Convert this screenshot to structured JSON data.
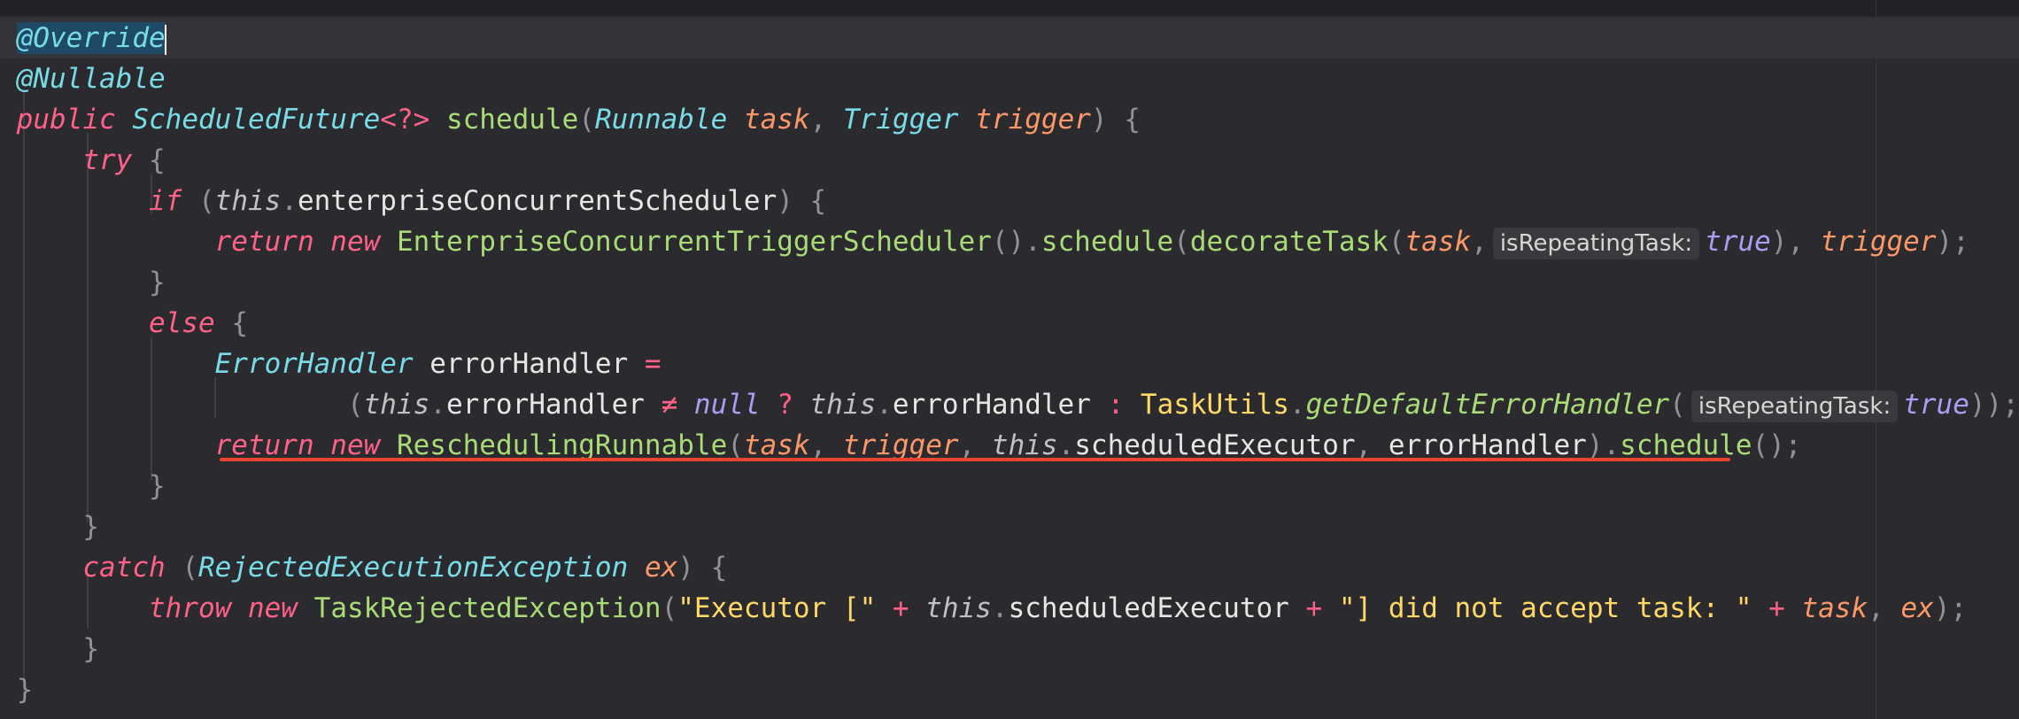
{
  "editor": {
    "language": "Java",
    "theme_colors": {
      "background": "#2b2a2e",
      "keyword": "#ff6188",
      "type": "#78dce8",
      "function": "#a9dc76",
      "parameter": "#fc9867",
      "literal": "#ab9df2",
      "string": "#ffd866",
      "error_underline": "#e8442e"
    },
    "tokens": {
      "override": "@Override",
      "override_head": "@Overrid",
      "override_tail": "e",
      "nullable": "@Nullable",
      "public": "public",
      "scheduled_future": "ScheduledFuture",
      "generic": "<?>",
      "schedule": "schedule",
      "runnable": "Runnable",
      "task": "task",
      "trigger_type": "Trigger",
      "trigger": "trigger",
      "try": "try",
      "if": "if",
      "this": "this",
      "enterprise_scheduler": "enterpriseConcurrentScheduler",
      "return": "return",
      "new": "new",
      "enterprise_trigger_scheduler": "EnterpriseConcurrentTriggerScheduler",
      "decorate_task": "decorateTask",
      "hint_repeating": "isRepeatingTask:",
      "true": "true",
      "else": "else",
      "error_handler_type": "ErrorHandler",
      "error_handler_var": "errorHandler",
      "neq": "≠",
      "null": "null",
      "task_utils": "TaskUtils",
      "get_default_error_handler": "getDefaultErrorHandler",
      "rescheduling_runnable": "ReschedulingRunnable",
      "scheduled_executor": "scheduledExecutor",
      "catch": "catch",
      "rejected_exception": "RejectedExecutionException",
      "ex": "ex",
      "throw": "throw",
      "task_rejected_exception": "TaskRejectedException",
      "str1": "\"Executor [\"",
      "str2": "\"] did not accept task: \""
    }
  }
}
